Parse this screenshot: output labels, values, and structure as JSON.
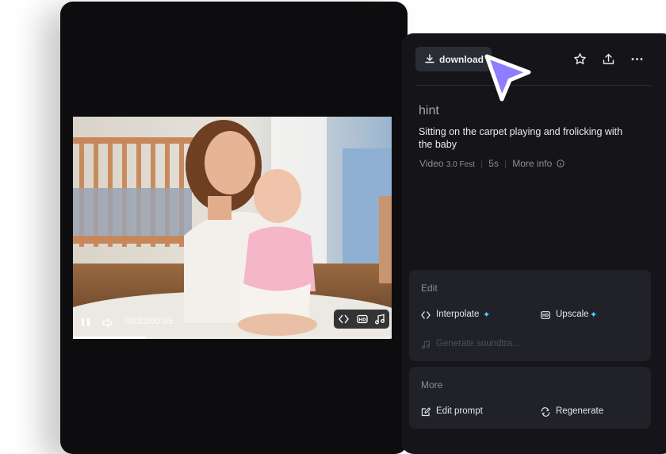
{
  "video": {
    "time": "00:02/00:05",
    "progress": 0.23
  },
  "sidebar": {
    "download_label": "download",
    "hint_title": "hint",
    "prompt": "Sitting on the carpet playing and frolicking with the baby",
    "meta": {
      "type": "Video",
      "model": "3.0 Fest",
      "duration": "5s",
      "more_info": "More info"
    }
  },
  "edit": {
    "title": "Edit",
    "interpolate": "Interpolate",
    "upscale": "Upscale",
    "generate_soundtrack": "Generate soundtra..."
  },
  "more": {
    "title": "More",
    "edit_prompt": "Edit prompt",
    "regenerate": "Regenerate"
  },
  "colors": {
    "accent_spark": "#4fd0ff",
    "cursor": "#8f7dff",
    "panel_bg": "#151519",
    "card_bg": "#212228"
  },
  "icons": [
    "download-icon",
    "star-icon",
    "share-icon",
    "more-icon",
    "pause-icon",
    "volume-icon",
    "interpolate-icon",
    "hd-icon",
    "music-icon",
    "info-icon",
    "edit-icon",
    "regenerate-icon",
    "cursor-icon"
  ]
}
